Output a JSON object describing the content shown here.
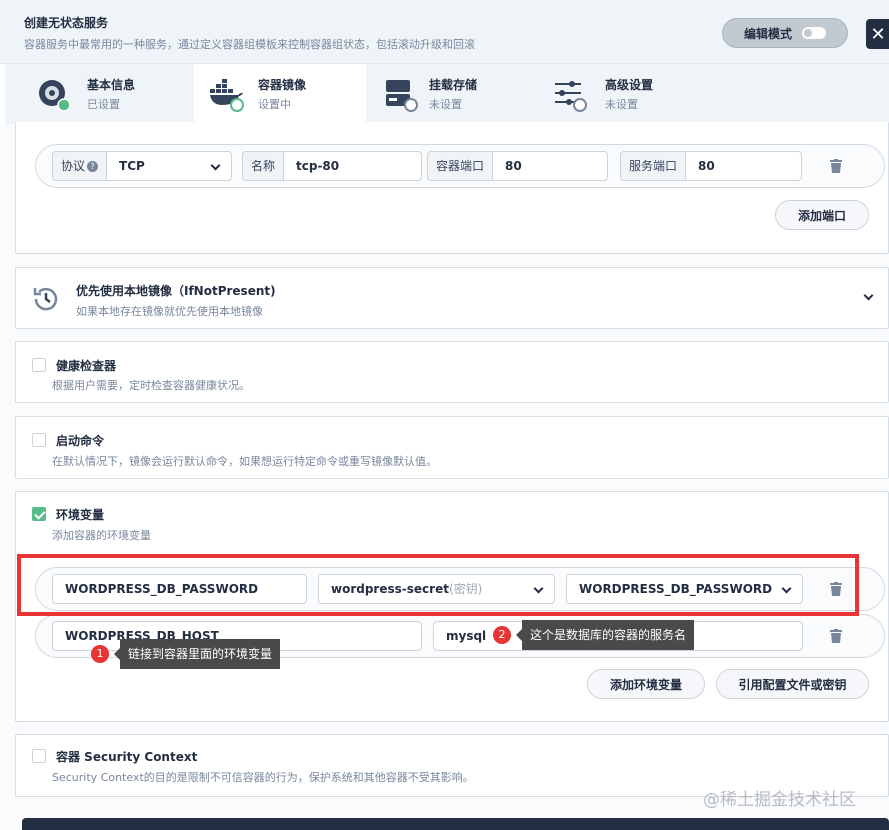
{
  "header": {
    "title": "创建无状态服务",
    "description": "容器服务中最常用的一种服务，通过定义容器组模板来控制容器组状态，包括滚动升级和回滚",
    "edit_mode_label": "编辑模式"
  },
  "tabs": [
    {
      "name": "基本信息",
      "status": "已设置"
    },
    {
      "name": "容器镜像",
      "status": "设置中"
    },
    {
      "name": "挂载存储",
      "status": "未设置"
    },
    {
      "name": "高级设置",
      "status": "未设置"
    }
  ],
  "ports": {
    "protocol_label": "协议",
    "protocol_value": "TCP",
    "name_label": "名称",
    "name_value": "tcp-80",
    "container_port_label": "容器端口",
    "container_port_value": "80",
    "service_port_label": "服务端口",
    "service_port_value": "80",
    "add_port_label": "添加端口"
  },
  "image_pull": {
    "title": "优先使用本地镜像（IfNotPresent)",
    "description": "如果本地存在镜像就优先使用本地镜像"
  },
  "health_check": {
    "title": "健康检查器",
    "description": "根据用户需要，定时检查容器健康状况。"
  },
  "startup_command": {
    "title": "启动命令",
    "description": "在默认情况下，镜像会运行默认命令，如果想运行特定命令或重写镜像默认值。"
  },
  "env": {
    "title": "环境变量",
    "description": "添加容器的环境变量",
    "row1": {
      "key": "WORDPRESS_DB_PASSWORD",
      "source": "wordpress-secret",
      "source_suffix": "(密钥)",
      "secret_key": "WORDPRESS_DB_PASSWORD"
    },
    "row2": {
      "key": "WORDPRESS_DB_HOST",
      "value": "mysql"
    },
    "add_env_label": "添加环境变量",
    "ref_config_label": "引用配置文件或密钥"
  },
  "security": {
    "title": "容器 Security Context",
    "description": "Security Context的目的是限制不可信容器的行为，保护系统和其他容器不受其影响。"
  },
  "annotations": {
    "marker1": "1",
    "tip1": "链接到容器里面的环境变量",
    "marker2": "2",
    "tip2": "这个是数据库的容器的服务名"
  },
  "watermark": "@稀土掘金技术社区",
  "colors": {
    "accent_green": "#55bc8a",
    "annotation_red": "#e83434",
    "dark": "#242e42"
  }
}
